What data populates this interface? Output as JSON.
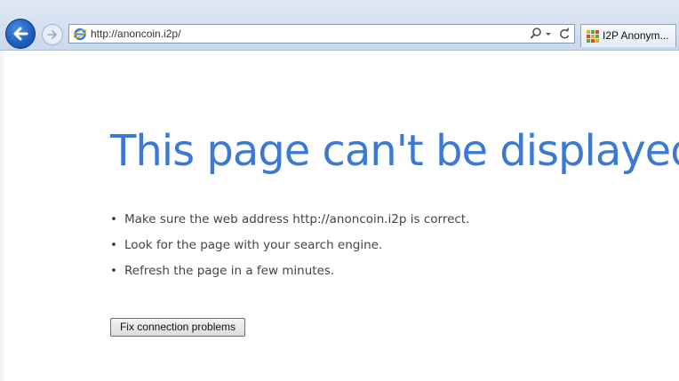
{
  "browser": {
    "address_url": "http://anoncoin.i2p/",
    "tab_title": "I2P Anonym..."
  },
  "icons": {
    "back": "back-arrow-icon",
    "forward": "forward-arrow-icon",
    "site": "ie-logo-icon",
    "search": "search-icon",
    "dropdown": "dropdown-icon",
    "refresh": "refresh-icon",
    "tab": "i2p-favicon-icon"
  },
  "colors": {
    "title": "#3b79d3",
    "body_text": "#444444",
    "back_button": "#1f5fc0"
  },
  "error": {
    "title": "This page can't be displayed",
    "bullet_char": "•",
    "suggestions": [
      "Make sure the web address http://anoncoin.i2p is correct.",
      "Look for the page with your search engine.",
      "Refresh the page in a few minutes."
    ],
    "fix_button": "Fix connection problems"
  }
}
